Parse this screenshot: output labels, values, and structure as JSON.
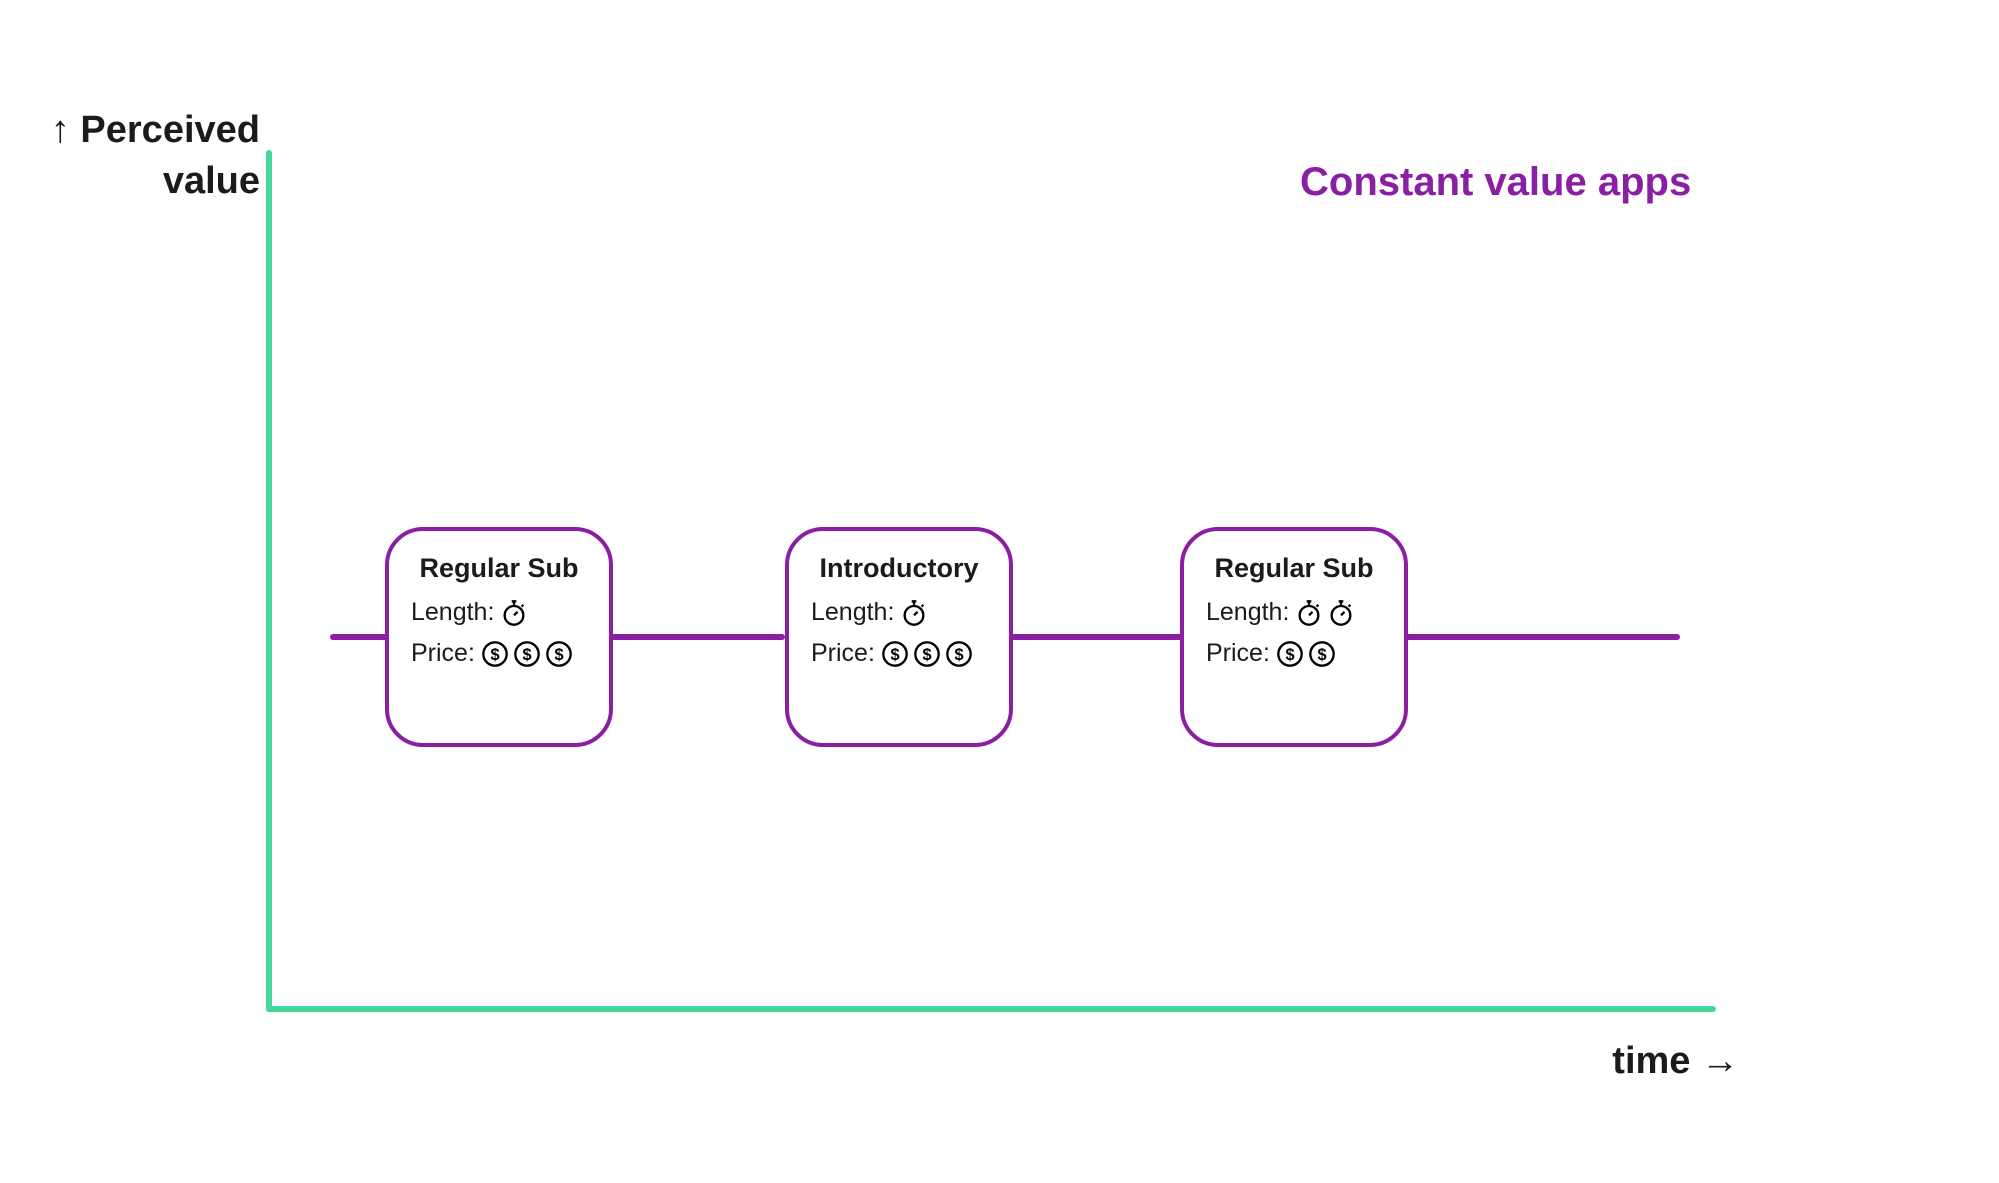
{
  "chart_data": {
    "type": "diagram",
    "title": "Constant value apps",
    "ylabel": "↑ Perceived value",
    "xlabel": "time →",
    "value_level": "constant",
    "cards": [
      {
        "title": "Regular Sub",
        "length_label": "Length:",
        "price_label": "Price:",
        "length_icons": 1,
        "price_icons": 3
      },
      {
        "title": "Introductory",
        "length_label": "Length:",
        "price_label": "Price:",
        "length_icons": 1,
        "price_icons": 3
      },
      {
        "title": "Regular Sub",
        "length_label": "Length:",
        "price_label": "Price:",
        "length_icons": 2,
        "price_icons": 2
      }
    ]
  },
  "icons": {
    "stopwatch": "stopwatch-icon",
    "dollar": "dollar-circle-icon"
  }
}
